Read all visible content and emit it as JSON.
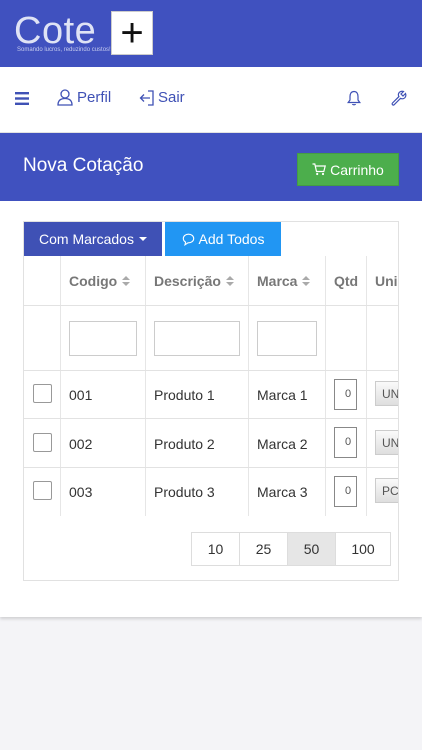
{
  "brand": {
    "logo_word": "Cote",
    "logo_mark": "+",
    "tagline": "Somando lucros, reduzindo custos!"
  },
  "nav": {
    "menu_icon": "hamburger-icon",
    "perfil_label": "Perfil",
    "sair_label": "Sair",
    "bell_icon": "bell-icon",
    "settings_icon": "wrench-icon"
  },
  "page": {
    "title": "Nova Cotação",
    "cart_label": "Carrinho"
  },
  "toolbar": {
    "marcados_label": "Com Marcados",
    "add_todos_label": "Add Todos"
  },
  "table": {
    "headers": {
      "codigo": "Codigo",
      "descricao": "Descrição",
      "marca": "Marca",
      "qtd": "Qtd",
      "unidade": "Uni"
    },
    "rows": [
      {
        "codigo": "001",
        "descricao": "Produto 1",
        "marca": "Marca 1",
        "qtd": "0",
        "unidade": "UN"
      },
      {
        "codigo": "002",
        "descricao": "Produto 2",
        "marca": "Marca 2",
        "qtd": "0",
        "unidade": "UN"
      },
      {
        "codigo": "003",
        "descricao": "Produto 3",
        "marca": "Marca 3",
        "qtd": "0",
        "unidade": "PC"
      }
    ]
  },
  "pagination": {
    "sizes": [
      "10",
      "25",
      "50",
      "100"
    ],
    "selected": "50"
  },
  "colors": {
    "primary": "#4051bf",
    "success": "#4cae4c",
    "info": "#2196f3"
  }
}
